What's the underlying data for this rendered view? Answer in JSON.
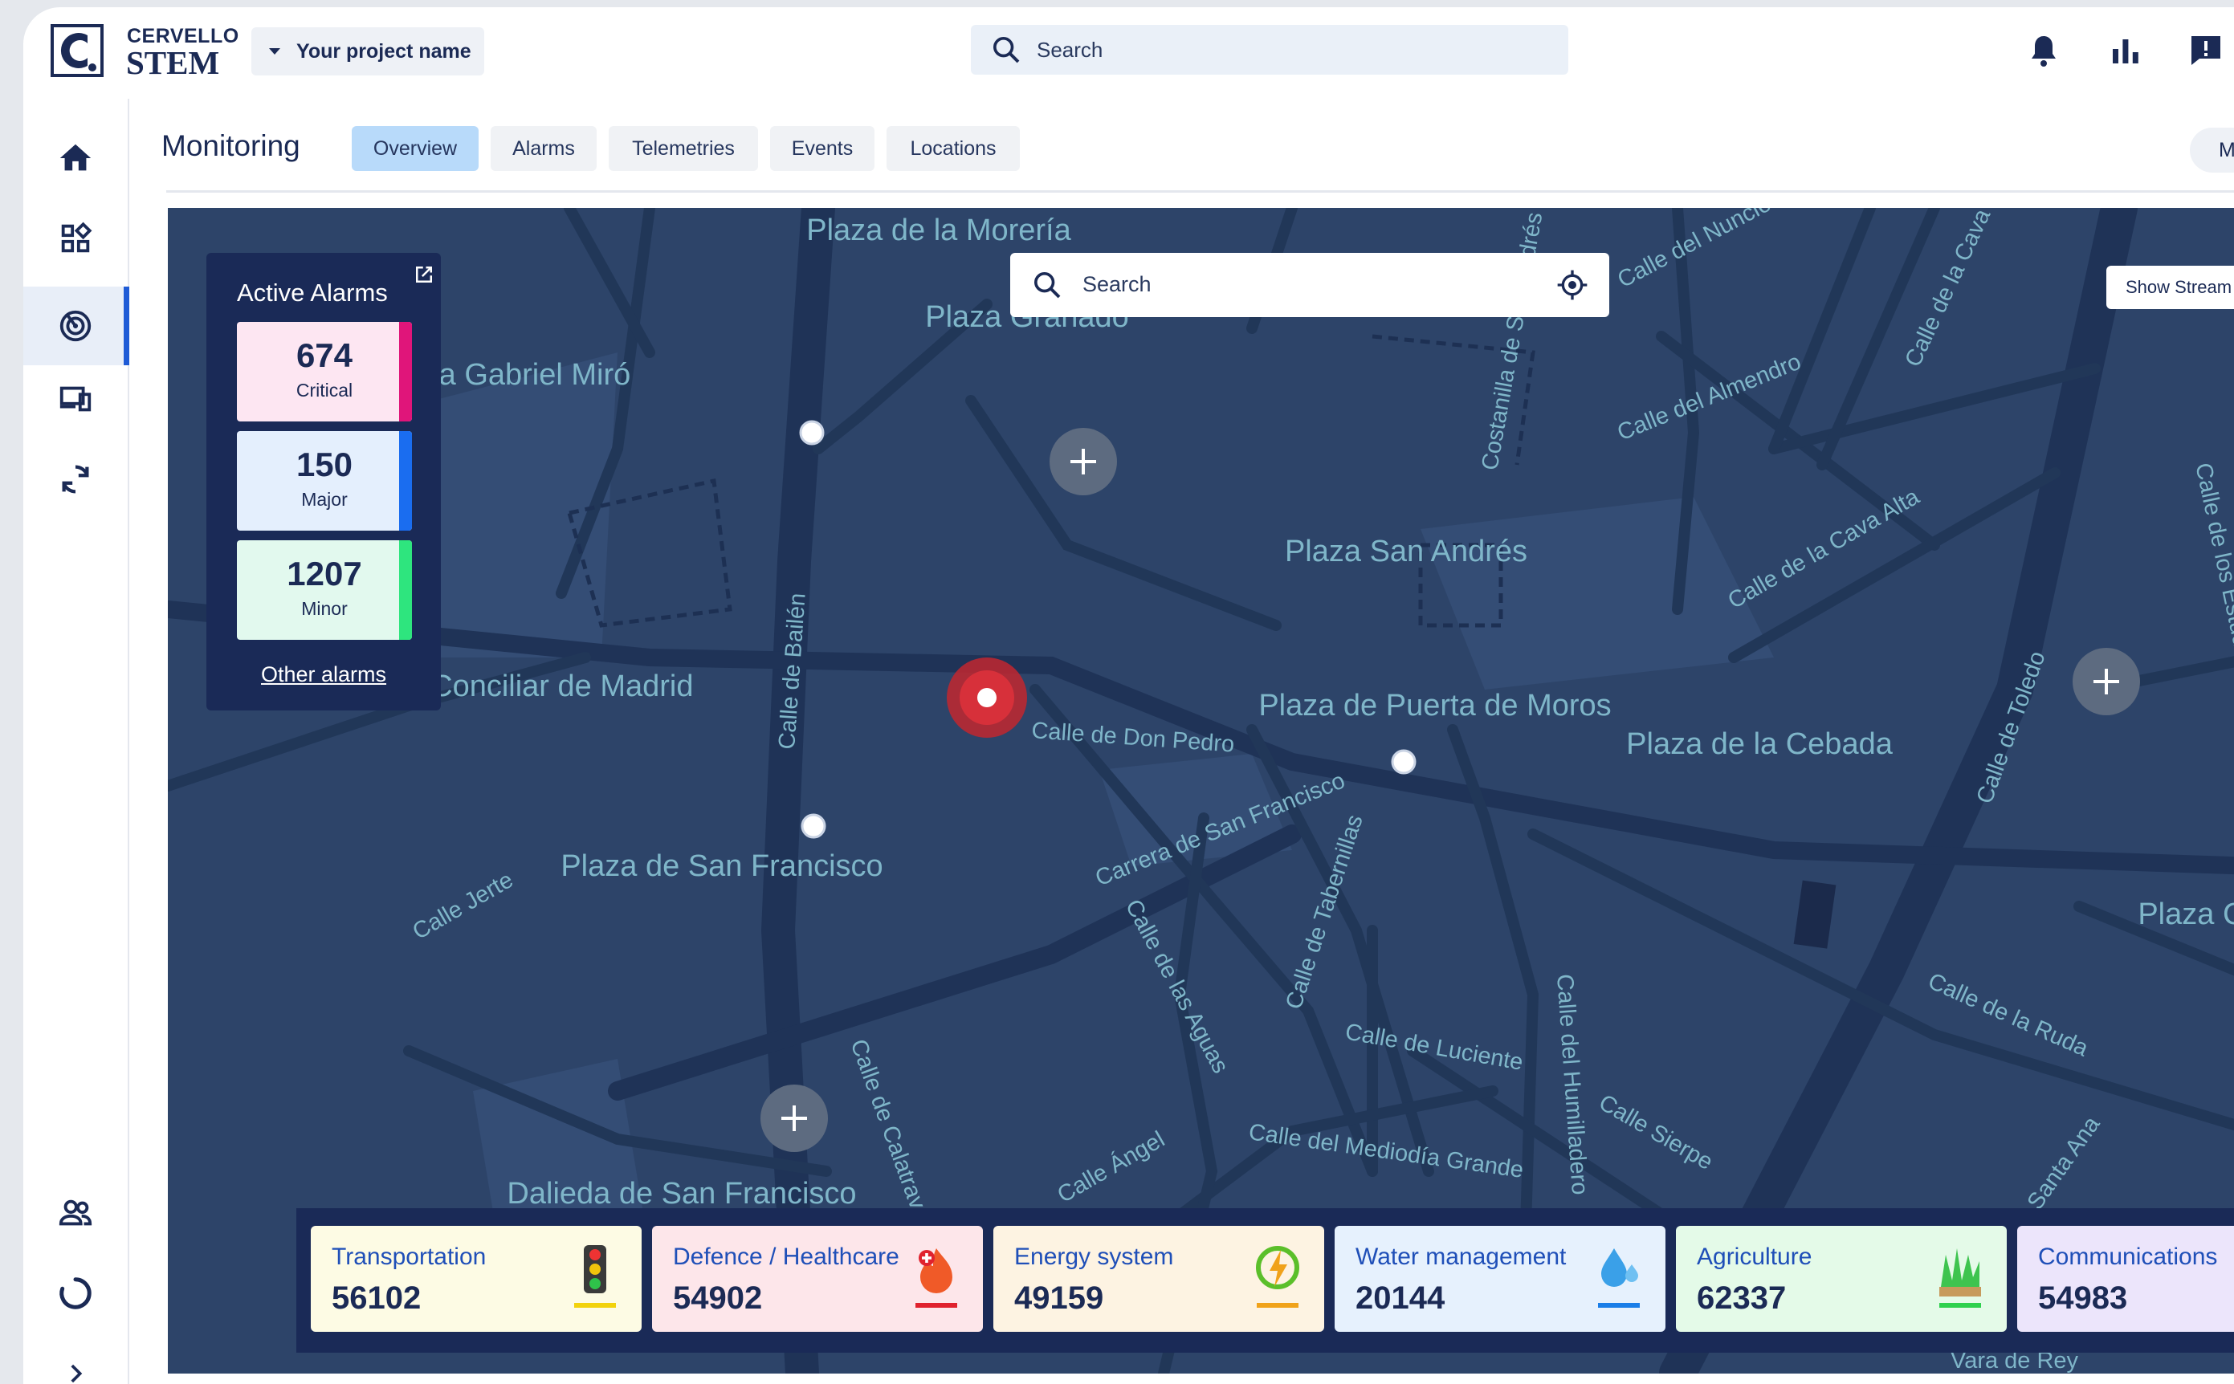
{
  "brand": {
    "line1": "CERVELLO",
    "line2": "STEM"
  },
  "header": {
    "project": "Your project name",
    "search_placeholder": "Search"
  },
  "page": {
    "title": "Monitoring",
    "tabs": [
      {
        "label": "Overview",
        "active": true
      },
      {
        "label": "Alarms"
      },
      {
        "label": "Telemetries"
      },
      {
        "label": "Events"
      },
      {
        "label": "Locations"
      }
    ],
    "right_pill": "M"
  },
  "map": {
    "search_placeholder": "Search",
    "show_stream": "Show Stream",
    "labels": [
      "Plaza de la Morería",
      "Plaza Granado",
      "Plaza Gabriel Miró",
      "Seminario Conciliar de Madrid",
      "Plaza San Andrés",
      "Plaza de Puerta de Moros",
      "Plaza de la Cebada",
      "Plaza de San Francisco",
      "Dalieda de San Francisco",
      "Plaza Casco",
      "Calle de Bailén",
      "Calle de Don Pedro",
      "Carrera de San Francisco",
      "Calle de las Aguas",
      "Calle de Tabernillas",
      "Calle de Luciente",
      "Calle del Humilladero",
      "Calle Sierpe",
      "Calle de Toledo",
      "Calle de la Ruda",
      "Calle del Almendro",
      "Calle de la Cava Alta",
      "Calle del Nuncio",
      "Costanilla de San Andrés",
      "Calle Jerte",
      "Calle Ángel",
      "Calle del Mediodía Grande",
      "Calle de Calatrava",
      "Calle de los Estudios",
      "Calle de la Cava",
      "Santa Ana",
      "Vara de Rey"
    ]
  },
  "alarms": {
    "title": "Active Alarms",
    "items": [
      {
        "count": "674",
        "label": "Critical",
        "bg": "#fde6f2",
        "edge": "#e0157a"
      },
      {
        "count": "150",
        "label": "Major",
        "bg": "#e4effd",
        "edge": "#1a6df0"
      },
      {
        "count": "1207",
        "label": "Minor",
        "bg": "#e2f9ee",
        "edge": "#2ee57e"
      }
    ],
    "other": "Other alarms"
  },
  "categories": [
    {
      "name": "Transportation",
      "value": "56102",
      "bg": "#fdfbe4",
      "accent": "#f2d20c",
      "icon": "traffic-light-icon"
    },
    {
      "name": "Defence / Healthcare",
      "value": "54902",
      "bg": "#fde6ea",
      "accent": "#e0222e",
      "icon": "fire-medical-icon"
    },
    {
      "name": "Energy system",
      "value": "49159",
      "bg": "#fdf3e2",
      "accent": "#f0a21a",
      "icon": "energy-icon"
    },
    {
      "name": "Water management",
      "value": "20144",
      "bg": "#e6f1fd",
      "accent": "#1a7ee8",
      "icon": "water-drop-icon"
    },
    {
      "name": "Agriculture",
      "value": "62337",
      "bg": "#e4fae8",
      "accent": "#2ed14e",
      "icon": "grass-icon"
    },
    {
      "name": "Communications",
      "value": "54983",
      "bg": "#ece5fb",
      "accent": "#7c4ce0",
      "icon": "antenna-icon"
    }
  ]
}
